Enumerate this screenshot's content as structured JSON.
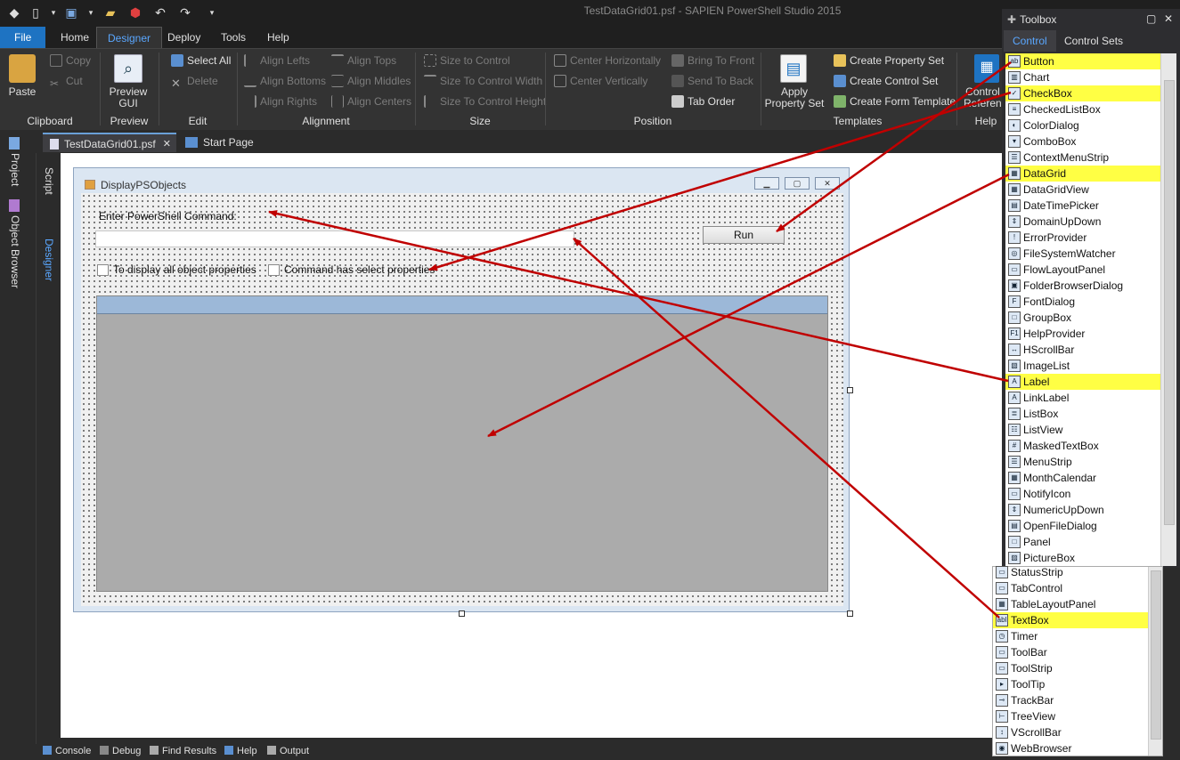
{
  "window": {
    "title": "TestDataGrid01.psf - SAPIEN PowerShell Studio 2015"
  },
  "ribbon": {
    "tabs": [
      "File",
      "Home",
      "Designer",
      "Deploy",
      "Tools",
      "Help"
    ],
    "clipboard": {
      "paste": "Paste",
      "copy": "Copy",
      "cut": "Cut",
      "label": "Clipboard"
    },
    "preview": {
      "preview_gui": [
        "Preview",
        "GUI"
      ],
      "label": "Preview"
    },
    "edit": {
      "select_all": "Select All",
      "delete": "Delete",
      "label": "Edit"
    },
    "alignment": {
      "align_lefts": "Align Lefts",
      "align_bottoms": "Align Bottoms",
      "align_rights": "Align Rights",
      "align_tops": "Align Tops",
      "align_middles": "Align Middles",
      "align_centers": "Align Centers",
      "label": "Alignment"
    },
    "size": {
      "size_to_control": "Size to Control",
      "size_to_control_width": "Size To Control Width",
      "size_to_control_height": "Size To Control Height",
      "label": "Size"
    },
    "position": {
      "center_h": "Center Horizontally",
      "center_v": "Center Vertically",
      "bring_front": "Bring To Front",
      "send_back": "Send To Back",
      "tab_order": "Tab Order",
      "label": "Position"
    },
    "templates": {
      "apply_property_set": [
        "Apply",
        "Property Set"
      ],
      "create_property_set": "Create Property Set",
      "create_control_set": "Create Control Set",
      "create_form_template": "Create Form Template",
      "label": "Templates"
    },
    "help": {
      "control_reference": [
        "Control",
        "Reference"
      ],
      "label": "Help"
    }
  },
  "doc_tabs": {
    "file_tab": "TestDataGrid01.psf",
    "close": "✕",
    "start_page": "Start Page"
  },
  "side_tabs": {
    "project": "Project",
    "object_browser": "Object Browser",
    "script": "Script",
    "designer": "Designer"
  },
  "form": {
    "caption": "DisplayPSObjects",
    "label_command": "Enter PowerShell Command:",
    "command_value": "",
    "run_button": "Run",
    "checkbox1": "To display all object properties",
    "checkbox2": "Command has select properties"
  },
  "toolbox": {
    "title": "Toolbox",
    "tabs": [
      "Control",
      "Control Sets"
    ],
    "items": [
      {
        "name": "Button",
        "icon": "ab",
        "hl": true
      },
      {
        "name": "Chart",
        "icon": "▥",
        "hl": false
      },
      {
        "name": "CheckBox",
        "icon": "✓",
        "hl": true
      },
      {
        "name": "CheckedListBox",
        "icon": "≡",
        "hl": false
      },
      {
        "name": "ColorDialog",
        "icon": "◐",
        "hl": false
      },
      {
        "name": "ComboBox",
        "icon": "▾",
        "hl": false
      },
      {
        "name": "ContextMenuStrip",
        "icon": "☰",
        "hl": false
      },
      {
        "name": "DataGrid",
        "icon": "▦",
        "hl": true
      },
      {
        "name": "DataGridView",
        "icon": "▦",
        "hl": false
      },
      {
        "name": "DateTimePicker",
        "icon": "▤",
        "hl": false
      },
      {
        "name": "DomainUpDown",
        "icon": "⇕",
        "hl": false
      },
      {
        "name": "ErrorProvider",
        "icon": "!",
        "hl": false
      },
      {
        "name": "FileSystemWatcher",
        "icon": "◎",
        "hl": false
      },
      {
        "name": "FlowLayoutPanel",
        "icon": "▭",
        "hl": false
      },
      {
        "name": "FolderBrowserDialog",
        "icon": "▣",
        "hl": false
      },
      {
        "name": "FontDialog",
        "icon": "F",
        "hl": false
      },
      {
        "name": "GroupBox",
        "icon": "□",
        "hl": false
      },
      {
        "name": "HelpProvider",
        "icon": "F1",
        "hl": false
      },
      {
        "name": "HScrollBar",
        "icon": "↔",
        "hl": false
      },
      {
        "name": "ImageList",
        "icon": "▧",
        "hl": false
      },
      {
        "name": "Label",
        "icon": "A",
        "hl": true
      },
      {
        "name": "LinkLabel",
        "icon": "A",
        "hl": false
      },
      {
        "name": "ListBox",
        "icon": "≣",
        "hl": false
      },
      {
        "name": "ListView",
        "icon": "☷",
        "hl": false
      },
      {
        "name": "MaskedTextBox",
        "icon": "#",
        "hl": false
      },
      {
        "name": "MenuStrip",
        "icon": "☰",
        "hl": false
      },
      {
        "name": "MonthCalendar",
        "icon": "▦",
        "hl": false
      },
      {
        "name": "NotifyIcon",
        "icon": "▭",
        "hl": false
      },
      {
        "name": "NumericUpDown",
        "icon": "⇕",
        "hl": false
      },
      {
        "name": "OpenFileDialog",
        "icon": "▤",
        "hl": false
      },
      {
        "name": "Panel",
        "icon": "□",
        "hl": false
      },
      {
        "name": "PictureBox",
        "icon": "▨",
        "hl": false
      }
    ],
    "items2": [
      {
        "name": "StatusStrip",
        "icon": "▭",
        "hl": false
      },
      {
        "name": "TabControl",
        "icon": "▭",
        "hl": false
      },
      {
        "name": "TableLayoutPanel",
        "icon": "▦",
        "hl": false
      },
      {
        "name": "TextBox",
        "icon": "abl",
        "hl": true
      },
      {
        "name": "Timer",
        "icon": "◷",
        "hl": false
      },
      {
        "name": "ToolBar",
        "icon": "▭",
        "hl": false
      },
      {
        "name": "ToolStrip",
        "icon": "▭",
        "hl": false
      },
      {
        "name": "ToolTip",
        "icon": "▸",
        "hl": false
      },
      {
        "name": "TrackBar",
        "icon": "⊸",
        "hl": false
      },
      {
        "name": "TreeView",
        "icon": "⊢",
        "hl": false
      },
      {
        "name": "VScrollBar",
        "icon": "↕",
        "hl": false
      },
      {
        "name": "WebBrowser",
        "icon": "◉",
        "hl": false
      }
    ]
  },
  "status_bar": [
    "Console",
    "Debug",
    "Find Results",
    "Help",
    "Output"
  ],
  "colors": {
    "accent": "#1e73c2",
    "highlight": "#ffff44",
    "arrow": "#c00000"
  }
}
